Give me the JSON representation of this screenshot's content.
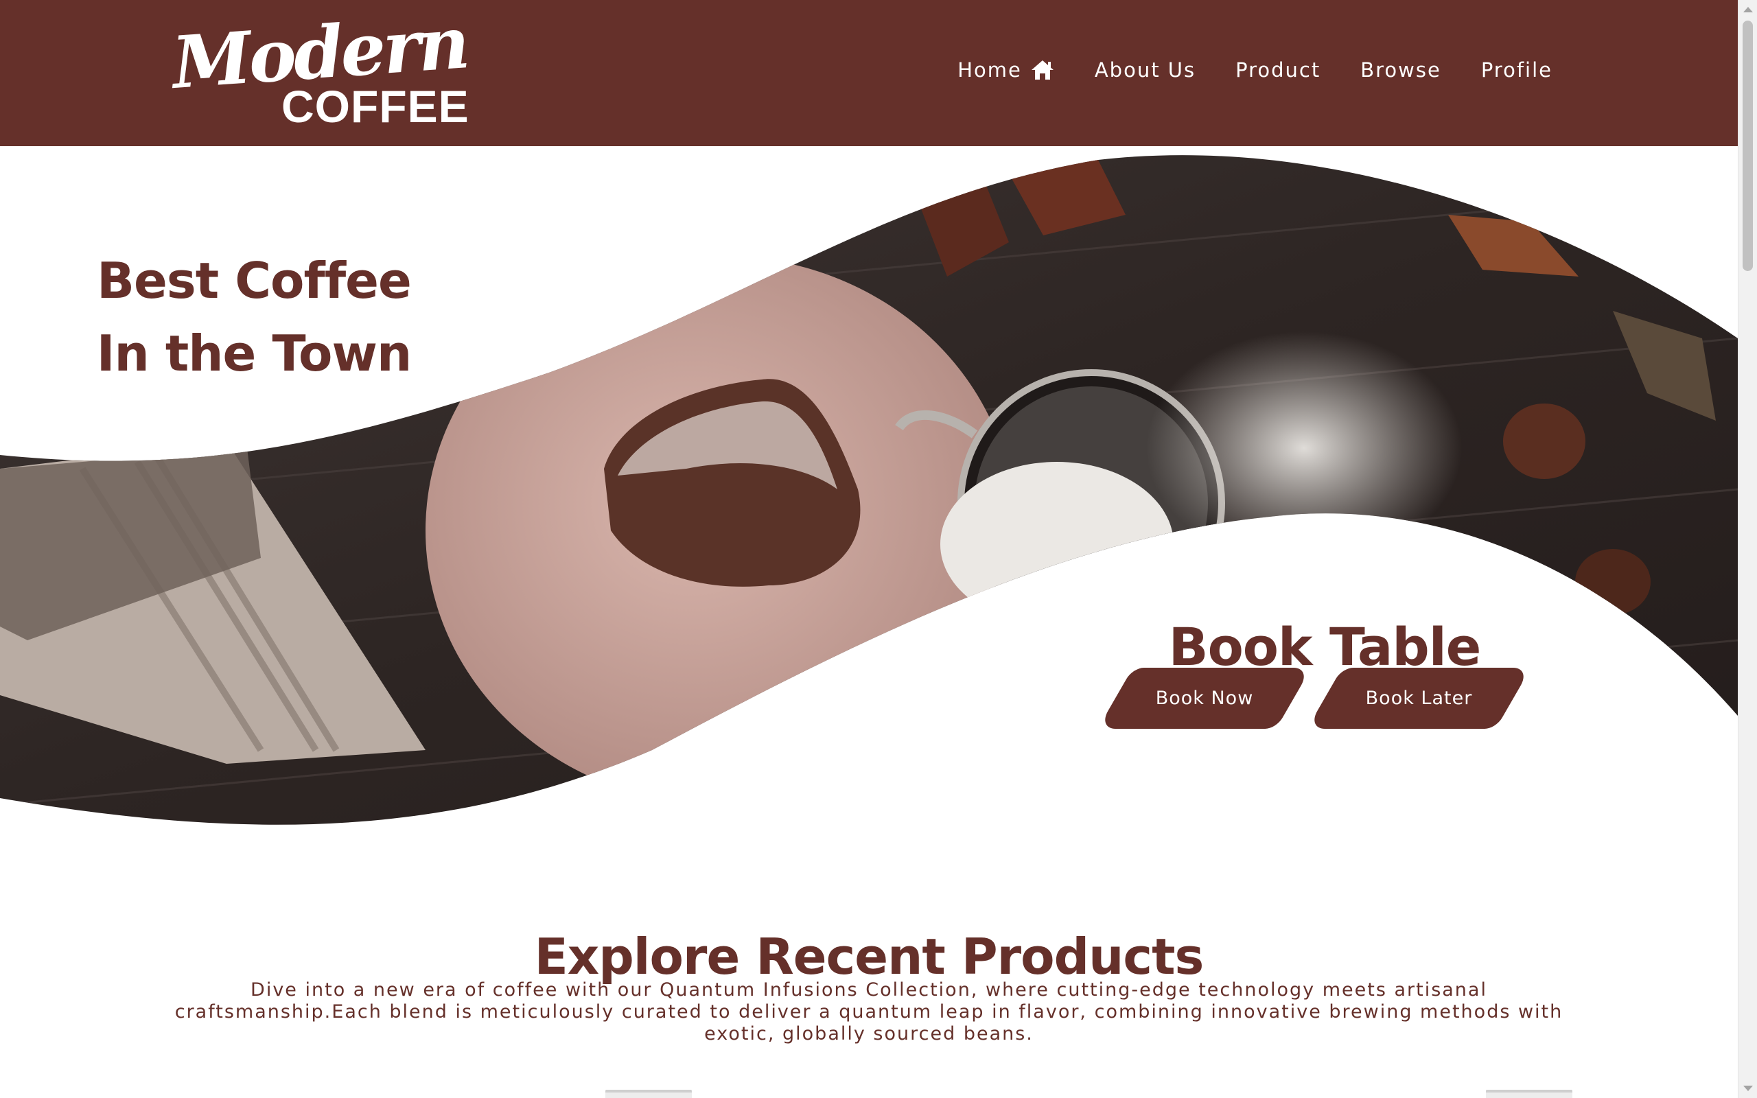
{
  "brand": {
    "script": "Modern",
    "word": "COFFEE"
  },
  "nav": {
    "items": [
      {
        "label": "Home",
        "icon": "home-icon"
      },
      {
        "label": "About Us"
      },
      {
        "label": "Product"
      },
      {
        "label": "Browse"
      },
      {
        "label": "Profile"
      }
    ]
  },
  "hero": {
    "title_line1": "Best Coffee",
    "title_line2": "In the Town",
    "book_title": "Book Table",
    "book_now_label": "Book Now",
    "book_later_label": "Book Later"
  },
  "products": {
    "title": "Explore Recent Products",
    "description": "Dive into a new era of coffee with our Quantum Infusions Collection, where cutting-edge technology meets artisanal craftsmanship.Each blend is meticulously curated to deliver a quantum leap in flavor, combining innovative brewing methods with exotic, globally sourced beans."
  },
  "colors": {
    "brand": "#65302a",
    "background": "#ffffff",
    "text_light": "#ffffff"
  }
}
